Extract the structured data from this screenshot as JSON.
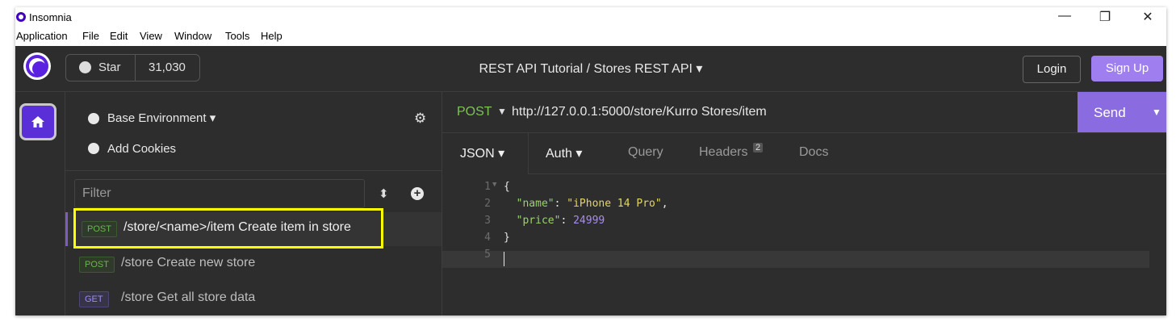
{
  "titlebar": {
    "title": "Insomnia",
    "minimize": "—",
    "restore": "❐",
    "close": "✕"
  },
  "menubar": [
    "Application",
    "File",
    "Edit",
    "View",
    "Window",
    "Tools",
    "Help"
  ],
  "header": {
    "star_label": "Star",
    "star_count": "31,030",
    "breadcrumb": "REST API Tutorial  /  Stores REST API  ▾",
    "login_label": "Login",
    "signup_label": "Sign Up"
  },
  "sidebar": {
    "environment": "Base Environment  ▾",
    "add_cookies": "Add Cookies",
    "filter_placeholder": "Filter",
    "requests": [
      {
        "method": "POST",
        "label": "/store/<name>/item Create item in store",
        "active": true
      },
      {
        "method": "POST",
        "label": "/store Create new store",
        "active": false
      },
      {
        "method": "GET",
        "label": "/store Get all store data",
        "active": false
      }
    ]
  },
  "request": {
    "method": "POST",
    "url": "http://127.0.0.1:5000/store/Kurro Stores/item",
    "send_label": "Send"
  },
  "tabs": [
    {
      "label": "JSON  ▾",
      "active": true
    },
    {
      "label": "Auth  ▾",
      "active": false
    },
    {
      "label": "Query",
      "active": false
    },
    {
      "label": "Headers",
      "active": false,
      "badge": "2"
    },
    {
      "label": "Docs",
      "active": false
    }
  ],
  "editor": {
    "lines": [
      "1",
      "2",
      "3",
      "4",
      "5"
    ],
    "body": {
      "name": "iPhone 14 Pro",
      "price": "24999"
    }
  },
  "colors": {
    "accent": "#8b6be0",
    "post": "#6cb64f",
    "get": "#9b8ef0",
    "highlight": "#ffff00"
  }
}
